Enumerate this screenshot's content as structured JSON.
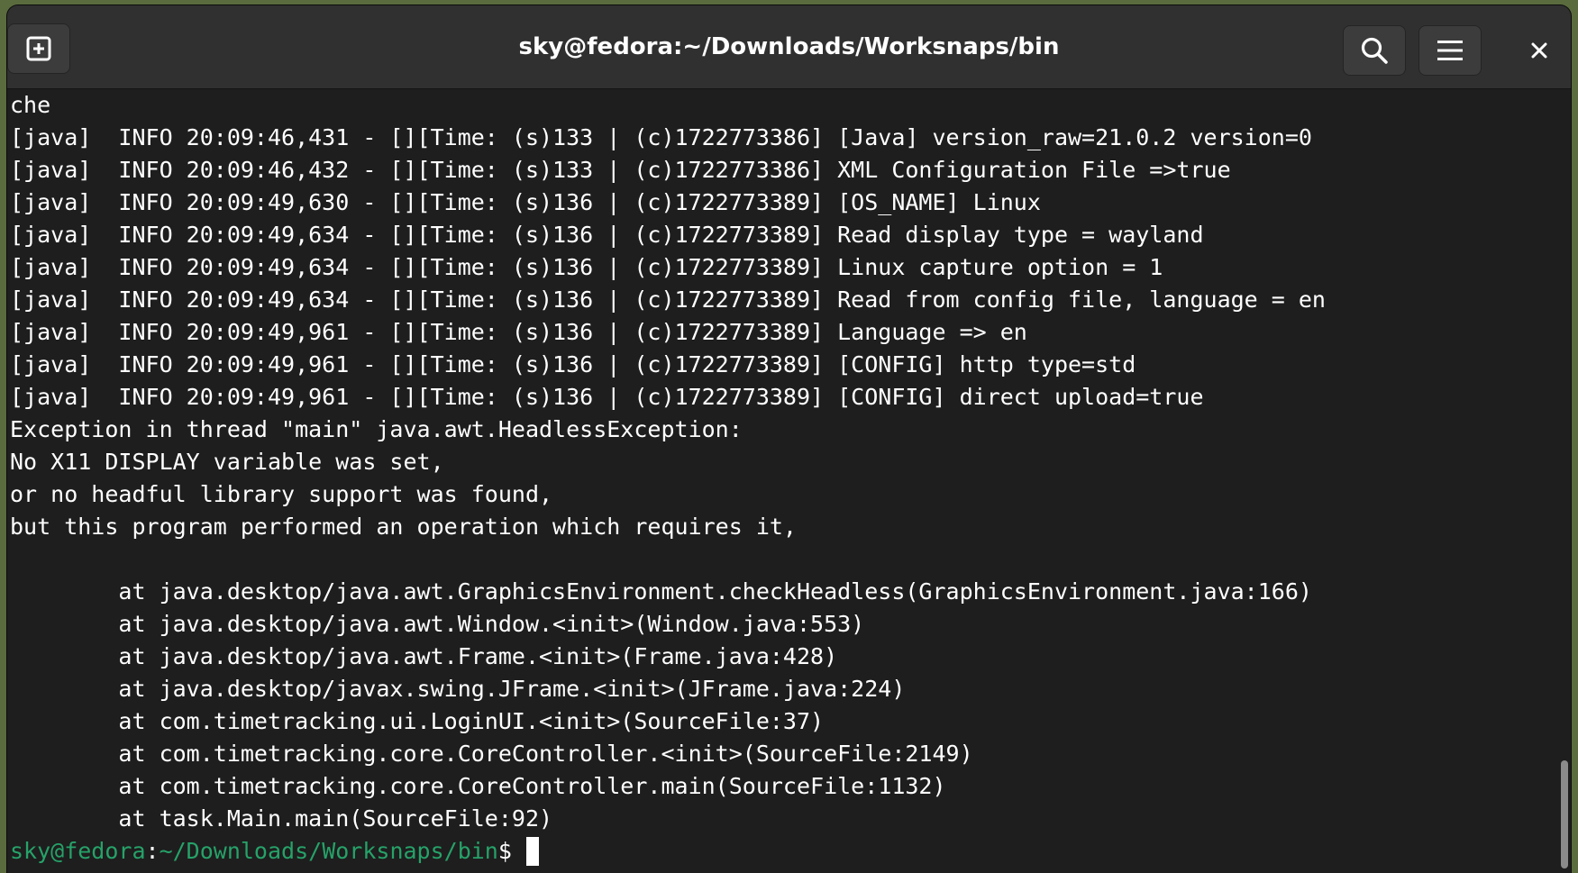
{
  "window": {
    "title": "sky@fedora:~/Downloads/Worksnaps/bin"
  },
  "header": {
    "new_tab_icon": "new-tab-plus-icon",
    "search_icon": "search-icon",
    "menu_icon": "hamburger-menu-icon",
    "close_icon": "close-icon"
  },
  "terminal": {
    "lines": [
      "che",
      "[java]  INFO 20:09:46,431 - [][Time: (s)133 | (c)1722773386] [Java] version_raw=21.0.2 version=0",
      "[java]  INFO 20:09:46,432 - [][Time: (s)133 | (c)1722773386] XML Configuration File =>true",
      "[java]  INFO 20:09:49,630 - [][Time: (s)136 | (c)1722773389] [OS_NAME] Linux",
      "[java]  INFO 20:09:49,634 - [][Time: (s)136 | (c)1722773389] Read display type = wayland",
      "[java]  INFO 20:09:49,634 - [][Time: (s)136 | (c)1722773389] Linux capture option = 1",
      "[java]  INFO 20:09:49,634 - [][Time: (s)136 | (c)1722773389] Read from config file, language = en",
      "[java]  INFO 20:09:49,961 - [][Time: (s)136 | (c)1722773389] Language => en",
      "[java]  INFO 20:09:49,961 - [][Time: (s)136 | (c)1722773389] [CONFIG] http type=std",
      "[java]  INFO 20:09:49,961 - [][Time: (s)136 | (c)1722773389] [CONFIG] direct upload=true",
      "Exception in thread \"main\" java.awt.HeadlessException:",
      "No X11 DISPLAY variable was set,",
      "or no headful library support was found,",
      "but this program performed an operation which requires it,",
      "",
      "        at java.desktop/java.awt.GraphicsEnvironment.checkHeadless(GraphicsEnvironment.java:166)",
      "        at java.desktop/java.awt.Window.<init>(Window.java:553)",
      "        at java.desktop/java.awt.Frame.<init>(Frame.java:428)",
      "        at java.desktop/javax.swing.JFrame.<init>(JFrame.java:224)",
      "        at com.timetracking.ui.LoginUI.<init>(SourceFile:37)",
      "        at com.timetracking.core.CoreController.<init>(SourceFile:2149)",
      "        at com.timetracking.core.CoreController.main(SourceFile:1132)",
      "        at task.Main.main(SourceFile:92)"
    ],
    "prompt": {
      "user_host": "sky@fedora",
      "colon": ":",
      "path": "~/Downloads/Worksnaps/bin",
      "dollar": "$"
    },
    "colors": {
      "background": "#1e1e1e",
      "text": "#ffffff",
      "prompt_green": "#26a269"
    }
  }
}
